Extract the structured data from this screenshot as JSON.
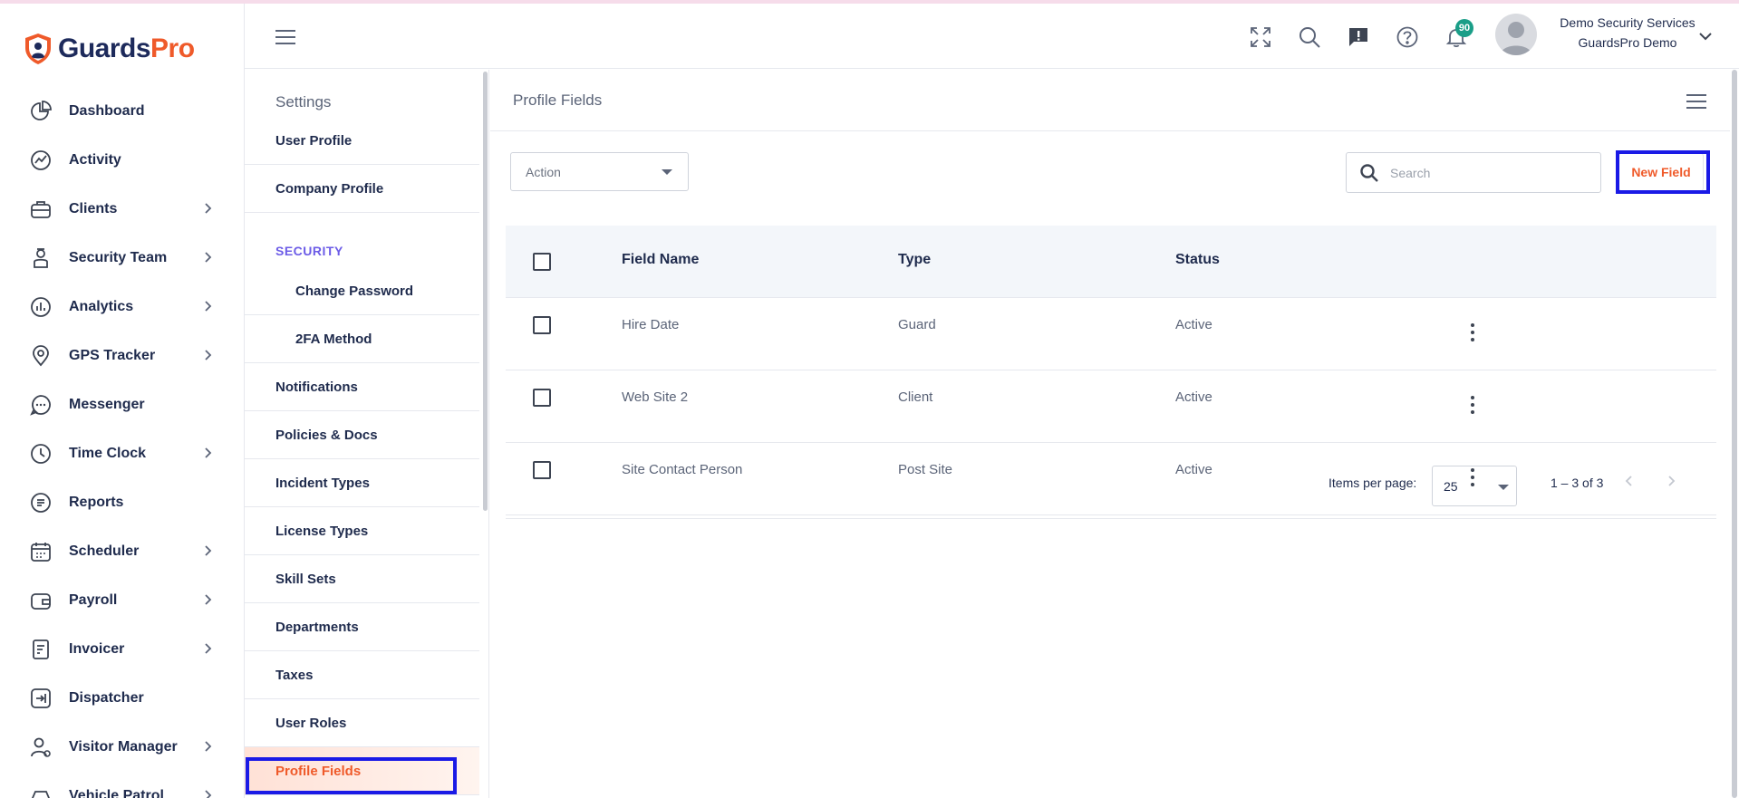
{
  "brand": {
    "name_primary": "Guards",
    "name_accent": "Pro"
  },
  "nav": [
    {
      "label": "Dashboard",
      "icon": "dashboard-icon",
      "has_chevron": false
    },
    {
      "label": "Activity",
      "icon": "activity-icon",
      "has_chevron": false
    },
    {
      "label": "Clients",
      "icon": "clients-icon",
      "has_chevron": true
    },
    {
      "label": "Security Team",
      "icon": "security-team-icon",
      "has_chevron": true
    },
    {
      "label": "Analytics",
      "icon": "analytics-icon",
      "has_chevron": true
    },
    {
      "label": "GPS Tracker",
      "icon": "gps-tracker-icon",
      "has_chevron": true
    },
    {
      "label": "Messenger",
      "icon": "messenger-icon",
      "has_chevron": false
    },
    {
      "label": "Time Clock",
      "icon": "time-clock-icon",
      "has_chevron": true
    },
    {
      "label": "Reports",
      "icon": "reports-icon",
      "has_chevron": false
    },
    {
      "label": "Scheduler",
      "icon": "scheduler-icon",
      "has_chevron": true
    },
    {
      "label": "Payroll",
      "icon": "payroll-icon",
      "has_chevron": true
    },
    {
      "label": "Invoicer",
      "icon": "invoicer-icon",
      "has_chevron": true
    },
    {
      "label": "Dispatcher",
      "icon": "dispatcher-icon",
      "has_chevron": false
    },
    {
      "label": "Visitor Manager",
      "icon": "visitor-manager-icon",
      "has_chevron": true
    },
    {
      "label": "Vehicle Patrol",
      "icon": "vehicle-patrol-icon",
      "has_chevron": true
    }
  ],
  "header": {
    "notification_count": "90",
    "company": "Demo Security Services",
    "user": "GuardsPro Demo"
  },
  "settings": {
    "title": "Settings",
    "items": [
      {
        "label": "User Profile"
      },
      {
        "label": "Company Profile"
      }
    ],
    "section_label": "SECURITY",
    "security_items": [
      {
        "label": "Change Password"
      },
      {
        "label": "2FA Method"
      }
    ],
    "more_items": [
      {
        "label": "Notifications"
      },
      {
        "label": "Policies & Docs"
      },
      {
        "label": "Incident Types"
      },
      {
        "label": "License Types"
      },
      {
        "label": "Skill Sets"
      },
      {
        "label": "Departments"
      },
      {
        "label": "Taxes"
      },
      {
        "label": "User Roles"
      },
      {
        "label": "Profile Fields"
      }
    ]
  },
  "main": {
    "title": "Profile Fields",
    "action_label": "Action",
    "search_placeholder": "Search",
    "new_button": "New Field",
    "columns": {
      "name": "Field Name",
      "type": "Type",
      "status": "Status"
    },
    "rows": [
      {
        "name": "Hire Date",
        "type": "Guard",
        "status": "Active"
      },
      {
        "name": "Web Site 2",
        "type": "Client",
        "status": "Active"
      },
      {
        "name": "Site Contact Person",
        "type": "Post Site",
        "status": "Active"
      }
    ],
    "paginator": {
      "items_per_page_label": "Items per page:",
      "page_size": "25",
      "range": "1 – 3 of 3"
    }
  },
  "colors": {
    "accent": "#ef5a2a",
    "brand_navy": "#1d2a5b",
    "section": "#6c5ce7",
    "badge": "#1a9e88",
    "highlight": "#1a1ae6"
  }
}
